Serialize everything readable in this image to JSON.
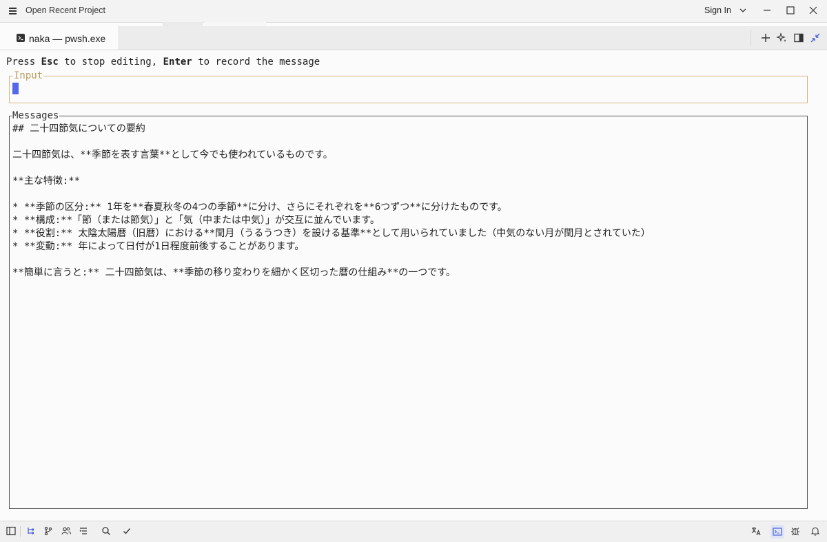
{
  "titlebar": {
    "title": "Open Recent Project",
    "sign_in": "Sign In",
    "icons": [
      "menu-icon",
      "chevron-down-icon",
      "minimize-icon",
      "maximize-icon",
      "close-icon"
    ]
  },
  "tab": {
    "label": "naka — pwsh.exe",
    "icon": "terminal-icon",
    "tools": [
      "plus-icon",
      "sparkle-icon",
      "split-pane-icon",
      "collapse-icon"
    ]
  },
  "terminal": {
    "hint": {
      "prefix": "Press ",
      "key1": "Esc",
      "middle": " to stop editing, ",
      "key2": "Enter",
      "suffix": " to record the message"
    },
    "input": {
      "legend": "Input",
      "value": ""
    },
    "messages": {
      "legend": "Messages",
      "lines": [
        "## 二十四節気についての要約",
        "",
        "二十四節気は、**季節を表す言葉**として今でも使われているものです。",
        "",
        "**主な特徴:**",
        "",
        "* **季節の区分:** 1年を**春夏秋冬の4つの季節**に分け、さらにそれぞれを**6つずつ**に分けたものです。",
        "* **構成:**「節（または節気）」と「気（中または中気）」が交互に並んでいます。",
        "* **役割:** 太陰太陽暦（旧暦）における**閏月（うるうつき）を設ける基準**として用いられていました（中気のない月が閏月とされていた）",
        "* **変動:** 年によって日付が1日程度前後することがあります。",
        "",
        "**簡単に言うと:** 二十四節気は、**季節の移り変わりを細かく区切った暦の仕組み**の一つです。"
      ]
    }
  },
  "colors": {
    "input_border": "#d4b67e",
    "cursor": "#5468e8",
    "messages_border": "#555555"
  },
  "statusbar": {
    "left_icons": [
      "sidebar-icon",
      "outline-icon",
      "git-branch-icon",
      "people-icon",
      "checklist-icon",
      "search-icon",
      "check-icon"
    ],
    "right_icons": [
      "translate-icon",
      "terminal-panel-icon",
      "debug-icon",
      "notification-icon"
    ]
  }
}
